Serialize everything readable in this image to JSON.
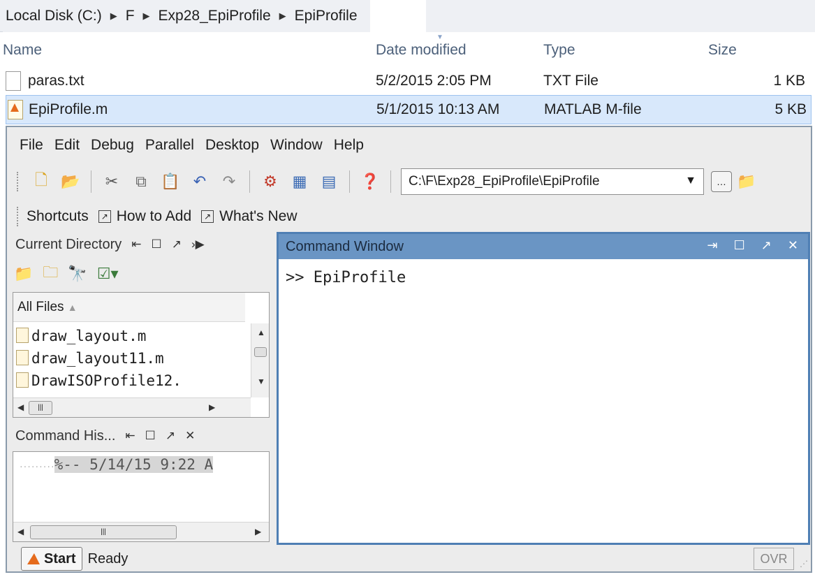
{
  "explorer": {
    "breadcrumb": [
      "Local Disk (C:)",
      "F",
      "Exp28_EpiProfile",
      "EpiProfile"
    ],
    "columns": {
      "name": "Name",
      "date": "Date modified",
      "type": "Type",
      "size": "Size"
    },
    "files": [
      {
        "name": "paras.txt",
        "date": "5/2/2015 2:05 PM",
        "type": "TXT File",
        "size": "1 KB"
      },
      {
        "name": "EpiProfile.m",
        "date": "5/1/2015 10:13 AM",
        "type": "MATLAB M-file",
        "size": "5 KB"
      }
    ]
  },
  "matlab": {
    "menu": [
      "File",
      "Edit",
      "Debug",
      "Parallel",
      "Desktop",
      "Window",
      "Help"
    ],
    "current_folder": "C:\\F\\Exp28_EpiProfile\\EpiProfile",
    "shortcuts": {
      "label": "Shortcuts",
      "how_to_add": "How to Add",
      "whats_new": "What's New"
    },
    "current_directory": {
      "title": "Current Directory",
      "filter": "All Files",
      "files": [
        "draw_layout.m",
        "draw_layout11.m",
        "DrawISOProfile12."
      ]
    },
    "command_history": {
      "title": "Command His...",
      "entry": "%-- 5/14/15   9:22 A"
    },
    "command_window": {
      "title": "Command Window",
      "prompt": ">> EpiProfile"
    },
    "status": {
      "start": "Start",
      "text": "Ready",
      "ovr": "OVR"
    }
  }
}
